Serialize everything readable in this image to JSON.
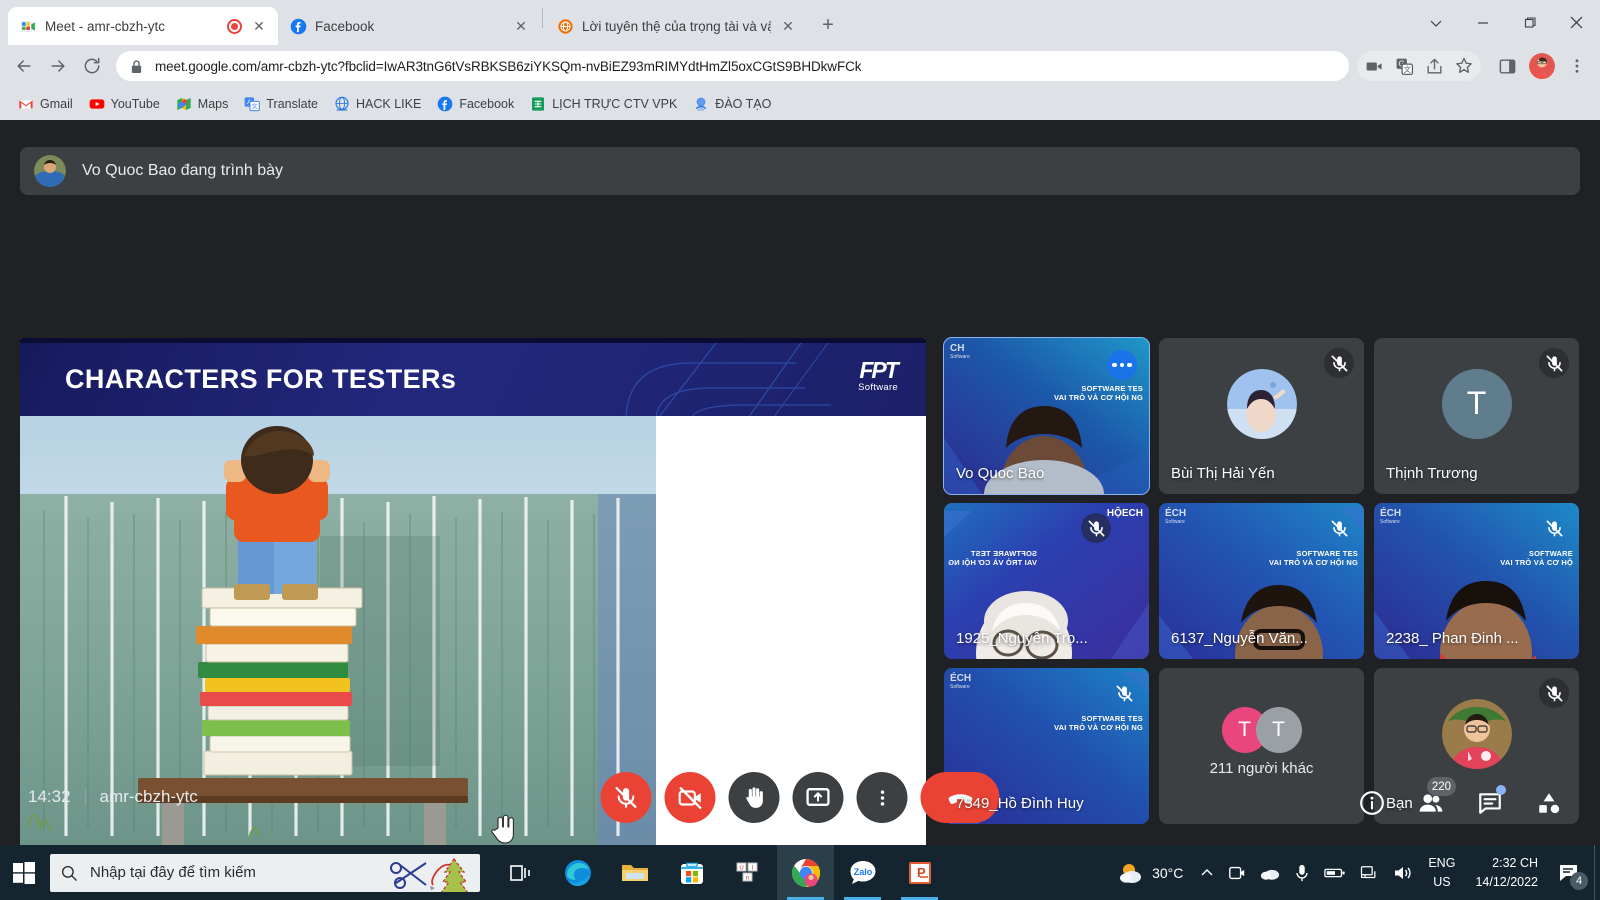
{
  "browser": {
    "tabs": [
      {
        "title": "Meet - amr-cbzh-ytc",
        "favicon": "google-meet-icon",
        "active": true,
        "recording": true,
        "close_label": "✕"
      },
      {
        "title": "Facebook",
        "favicon": "facebook-icon",
        "active": false,
        "recording": false,
        "close_label": "✕"
      },
      {
        "title": "Lời tuyên thệ của trọng tài và vận",
        "favicon": "globe-icon",
        "active": false,
        "recording": false,
        "close_label": "✕"
      }
    ],
    "new_tab_label": "+",
    "window_controls": {
      "minimize": "minimize-icon",
      "maximize": "maximize-icon",
      "close": "close-icon"
    },
    "nav": {
      "back": "back-arrow-icon",
      "forward": "forward-arrow-icon",
      "reload": "reload-icon"
    },
    "omnibox": {
      "lock": "lock-icon",
      "url": "meet.google.com/amr-cbzh-ytc?fbclid=IwAR3tnG6tVsRBKSB6ziYKSQm-nvBiEZ93mRIMYdtHmZl5oxCGtS9BHDkwFCk"
    },
    "toolbar_icons": [
      "video-camera-icon",
      "translate-icon",
      "share-icon",
      "bookmark-star-icon",
      "side-panel-icon",
      "profile-avatar",
      "more-vertical-icon"
    ],
    "bookmarks": [
      {
        "label": "Gmail",
        "icon": "gmail-icon"
      },
      {
        "label": "YouTube",
        "icon": "youtube-icon"
      },
      {
        "label": "Maps",
        "icon": "maps-icon"
      },
      {
        "label": "Translate",
        "icon": "translate-icon"
      },
      {
        "label": "HACK LIKE",
        "icon": "globe-blue-icon"
      },
      {
        "label": "Facebook",
        "icon": "facebook-icon"
      },
      {
        "label": "LỊCH TRỰC CTV VPK",
        "icon": "sheets-icon"
      },
      {
        "label": "ĐÀO TẠO",
        "icon": "docs-icon"
      }
    ]
  },
  "meet": {
    "presenting_banner": {
      "text": "Vo Quoc Bao đang trình bày",
      "avatar": "presenter-avatar"
    },
    "slide": {
      "title": "CHARACTERS FOR TESTERs",
      "logo_mark": "FPT",
      "logo_sub": "Software",
      "image_alt": "boy-standing-on-books-climbing-fence"
    },
    "tiles": [
      {
        "name": "Vo Quoc Bao",
        "type": "video",
        "muted": false,
        "active": true,
        "more": true,
        "corner_tag": "CH",
        "corner_sub": "Software",
        "bg_line1": "SOFTWARE TES",
        "bg_line2": "VAI TRÒ VÀ CƠ HỘI NG"
      },
      {
        "name": "Bùi Thị Hải Yến",
        "type": "avatar",
        "muted": true,
        "active": false
      },
      {
        "name": "Thịnh Trương",
        "type": "initial",
        "initial": "T",
        "muted": true,
        "active": false
      },
      {
        "name": "1925_Nguyễn Trọ...",
        "type": "video",
        "muted": true,
        "active": false,
        "corner_tag_right": "HỘECH",
        "bg_line1": "SOFTWARE TEST",
        "bg_line2": "VAI TRÒ VÀ CƠ HỘI NG",
        "mirrored": true
      },
      {
        "name": "6137_Nguyễn Văn...",
        "type": "video",
        "muted": true,
        "active": false,
        "corner_tag": "ÉCH",
        "corner_sub": "Software",
        "bg_line1": "SOFTWARE TES",
        "bg_line2": "VAI TRÒ VÀ CƠ HỘI NG"
      },
      {
        "name": "2238_ Phan Đinh ...",
        "type": "video",
        "muted": true,
        "active": false,
        "corner_tag": "ÉCH",
        "corner_sub": "Software",
        "bg_line1": "SOFTWARE",
        "bg_line2": "VAI TRÒ VÀ CƠ HỘ"
      },
      {
        "name": "7549_Hồ Đình Huy",
        "type": "video",
        "muted": true,
        "active": false,
        "corner_tag": "ÉCH",
        "corner_sub": "Software",
        "bg_line1": "SOFTWARE TES",
        "bg_line2": "VAI TRÒ VÀ CƠ HỘI NG"
      },
      {
        "name": "211 người khác",
        "type": "others",
        "muted": false,
        "active": false,
        "initials": [
          "T",
          "T"
        ]
      },
      {
        "name": "Bạn",
        "type": "avatar",
        "muted": true,
        "active": false
      }
    ],
    "bottom": {
      "time": "14:32",
      "meeting_code": "amr-cbzh-ytc",
      "controls": [
        {
          "name": "microphone-off-button",
          "icon": "mic-off-icon",
          "style": "danger"
        },
        {
          "name": "camera-off-button",
          "icon": "camera-off-icon",
          "style": "danger"
        },
        {
          "name": "raise-hand-button",
          "icon": "raise-hand-icon",
          "style": "normal"
        },
        {
          "name": "present-screen-button",
          "icon": "present-screen-icon",
          "style": "normal"
        },
        {
          "name": "more-options-button",
          "icon": "more-vertical-icon",
          "style": "normal"
        },
        {
          "name": "end-call-button",
          "icon": "end-call-icon",
          "style": "end"
        }
      ],
      "right_controls": [
        {
          "name": "meeting-details-button",
          "icon": "info-icon",
          "badge": null,
          "dot": false
        },
        {
          "name": "show-everyone-button",
          "icon": "people-icon",
          "badge": "220",
          "dot": false
        },
        {
          "name": "chat-button",
          "icon": "chat-icon",
          "badge": null,
          "dot": true
        },
        {
          "name": "activities-button",
          "icon": "activities-icon",
          "badge": null,
          "dot": false
        }
      ]
    }
  },
  "taskbar": {
    "start": "windows-start-icon",
    "search": {
      "placeholder": "Nhập tại đây để tìm kiếm",
      "icon": "search-icon",
      "decor": "scissors-and-tree-icon"
    },
    "apps": [
      {
        "name": "task-view",
        "icon": "task-view-icon",
        "active": false,
        "open": false
      },
      {
        "name": "microsoft-edge",
        "icon": "edge-icon",
        "active": false,
        "open": false
      },
      {
        "name": "file-explorer",
        "icon": "folder-icon",
        "active": false,
        "open": false
      },
      {
        "name": "microsoft-store",
        "icon": "store-icon",
        "active": false,
        "open": false
      },
      {
        "name": "unikey",
        "icon": "unikey-icon",
        "active": false,
        "open": false
      },
      {
        "name": "google-chrome",
        "icon": "chrome-icon",
        "active": true,
        "open": true
      },
      {
        "name": "zalo",
        "icon": "zalo-icon",
        "active": false,
        "open": true
      },
      {
        "name": "powerpoint",
        "icon": "powerpoint-icon",
        "active": false,
        "open": true
      }
    ],
    "weather": {
      "temperature": "30°C",
      "icon": "sun-cloud-icon"
    },
    "tray": {
      "chevron": "chevron-up-icon",
      "icons": [
        "camera-tray-icon",
        "onedrive-icon",
        "microphone-tray-icon",
        "battery-icon",
        "network-icon",
        "volume-icon"
      ]
    },
    "language": {
      "line1": "ENG",
      "line2": "US"
    },
    "clock": {
      "time": "2:32 CH",
      "date": "14/12/2022"
    },
    "notifications": {
      "icon": "notification-icon",
      "count": "4"
    }
  }
}
